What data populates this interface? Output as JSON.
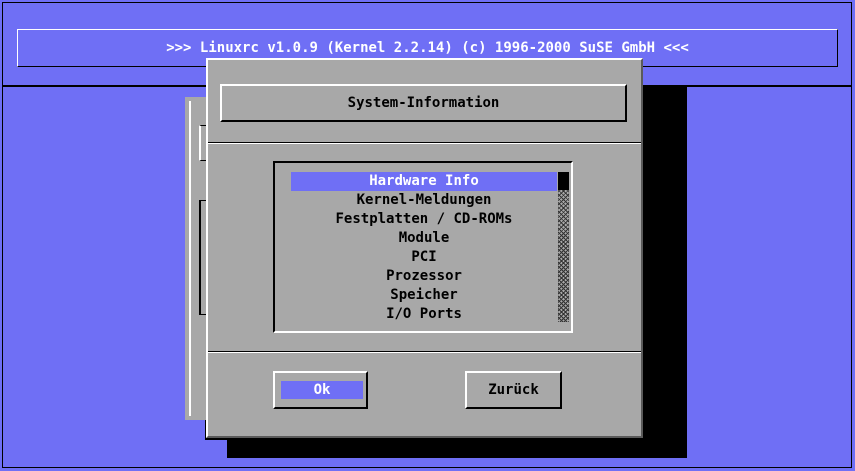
{
  "header": {
    "title": ">>> Linuxrc v1.0.9 (Kernel 2.2.14) (c) 1996-2000 SuSE GmbH <<<"
  },
  "dialog": {
    "title": "System-Information",
    "items": [
      {
        "label": "Hardware Info",
        "selected": true
      },
      {
        "label": "Kernel-Meldungen",
        "selected": false
      },
      {
        "label": "Festplatten / CD-ROMs",
        "selected": false
      },
      {
        "label": "Module",
        "selected": false
      },
      {
        "label": "PCI",
        "selected": false
      },
      {
        "label": "Prozessor",
        "selected": false
      },
      {
        "label": "Speicher",
        "selected": false
      },
      {
        "label": "I/O Ports",
        "selected": false
      }
    ],
    "ok_label": "Ok",
    "back_label": "Zurück"
  },
  "colors": {
    "background": "#6f6ff5",
    "dialog": "#a8a8a8",
    "highlight": "#6f6ff5"
  }
}
